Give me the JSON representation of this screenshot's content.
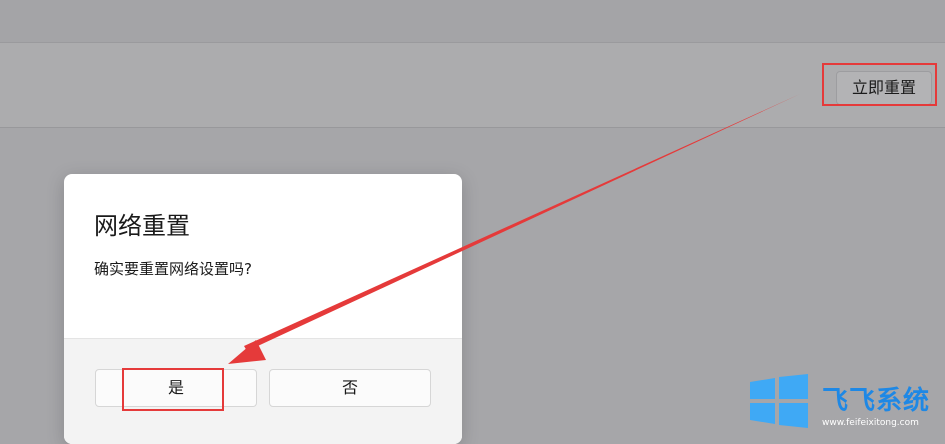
{
  "settings": {
    "reset_now_label": "立即重置"
  },
  "dialog": {
    "title": "网络重置",
    "message": "确实要重置网络设置吗?",
    "yes_label": "是",
    "no_label": "否"
  },
  "annotation": {
    "color": "#e53a3a"
  },
  "watermark": {
    "brand": "飞飞系统",
    "url": "www.feifeixitong.com",
    "logo_icon": "windows-logo-icon"
  },
  "colors": {
    "background": "#a6a6a9",
    "dialog": "#ffffff",
    "dialog_footer": "#f3f3f3",
    "brand": "#1e88e5"
  }
}
